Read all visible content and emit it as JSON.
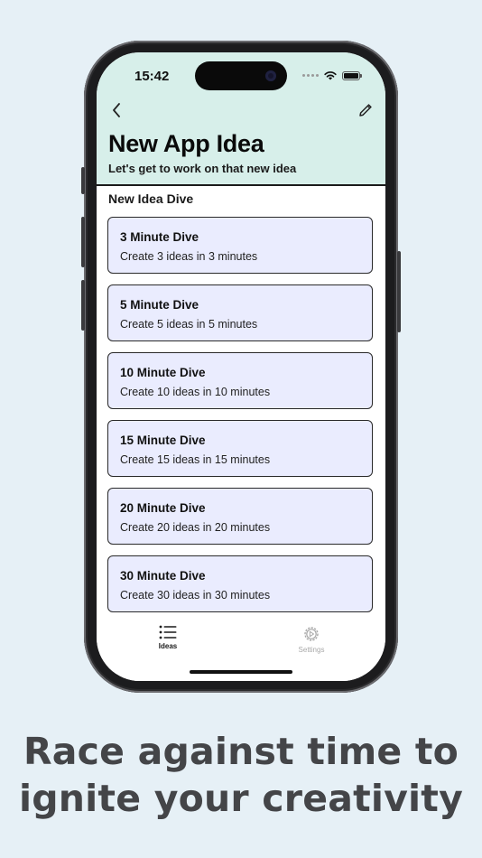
{
  "status_bar": {
    "time": "15:42",
    "icons": [
      "cellular-dots-icon",
      "wifi-icon",
      "battery-icon"
    ]
  },
  "nav": {
    "back_icon": "chevron-left-icon",
    "edit_icon": "pencil-icon"
  },
  "header": {
    "title": "New App Idea",
    "subtitle": "Let's get to work on that new idea"
  },
  "section": {
    "title": "New Idea Dive"
  },
  "dives": [
    {
      "title": "3 Minute Dive",
      "description": "Create 3 ideas in 3 minutes"
    },
    {
      "title": "5 Minute Dive",
      "description": "Create 5 ideas in 5 minutes"
    },
    {
      "title": "10 Minute Dive",
      "description": "Create 10 ideas in 10 minutes"
    },
    {
      "title": "15 Minute Dive",
      "description": "Create 15 ideas in 15 minutes"
    },
    {
      "title": "20 Minute Dive",
      "description": "Create 20 ideas in 20 minutes"
    },
    {
      "title": "30 Minute Dive",
      "description": "Create 30 ideas in 30 minutes"
    }
  ],
  "tabbar": {
    "tabs": [
      {
        "label": "Ideas",
        "icon": "list-icon",
        "selected": true
      },
      {
        "label": "Settings",
        "icon": "gear-icon",
        "selected": false
      }
    ]
  },
  "caption": {
    "line1": "Race against time to",
    "line2": "ignite your creativity"
  },
  "colors": {
    "background": "#e6f0f6",
    "header": "#d7efea",
    "card": "#eaecfe",
    "caption_text": "#444548",
    "tab_selected": "#1a1a1a",
    "tab_unselected": "#a8a8a8"
  }
}
